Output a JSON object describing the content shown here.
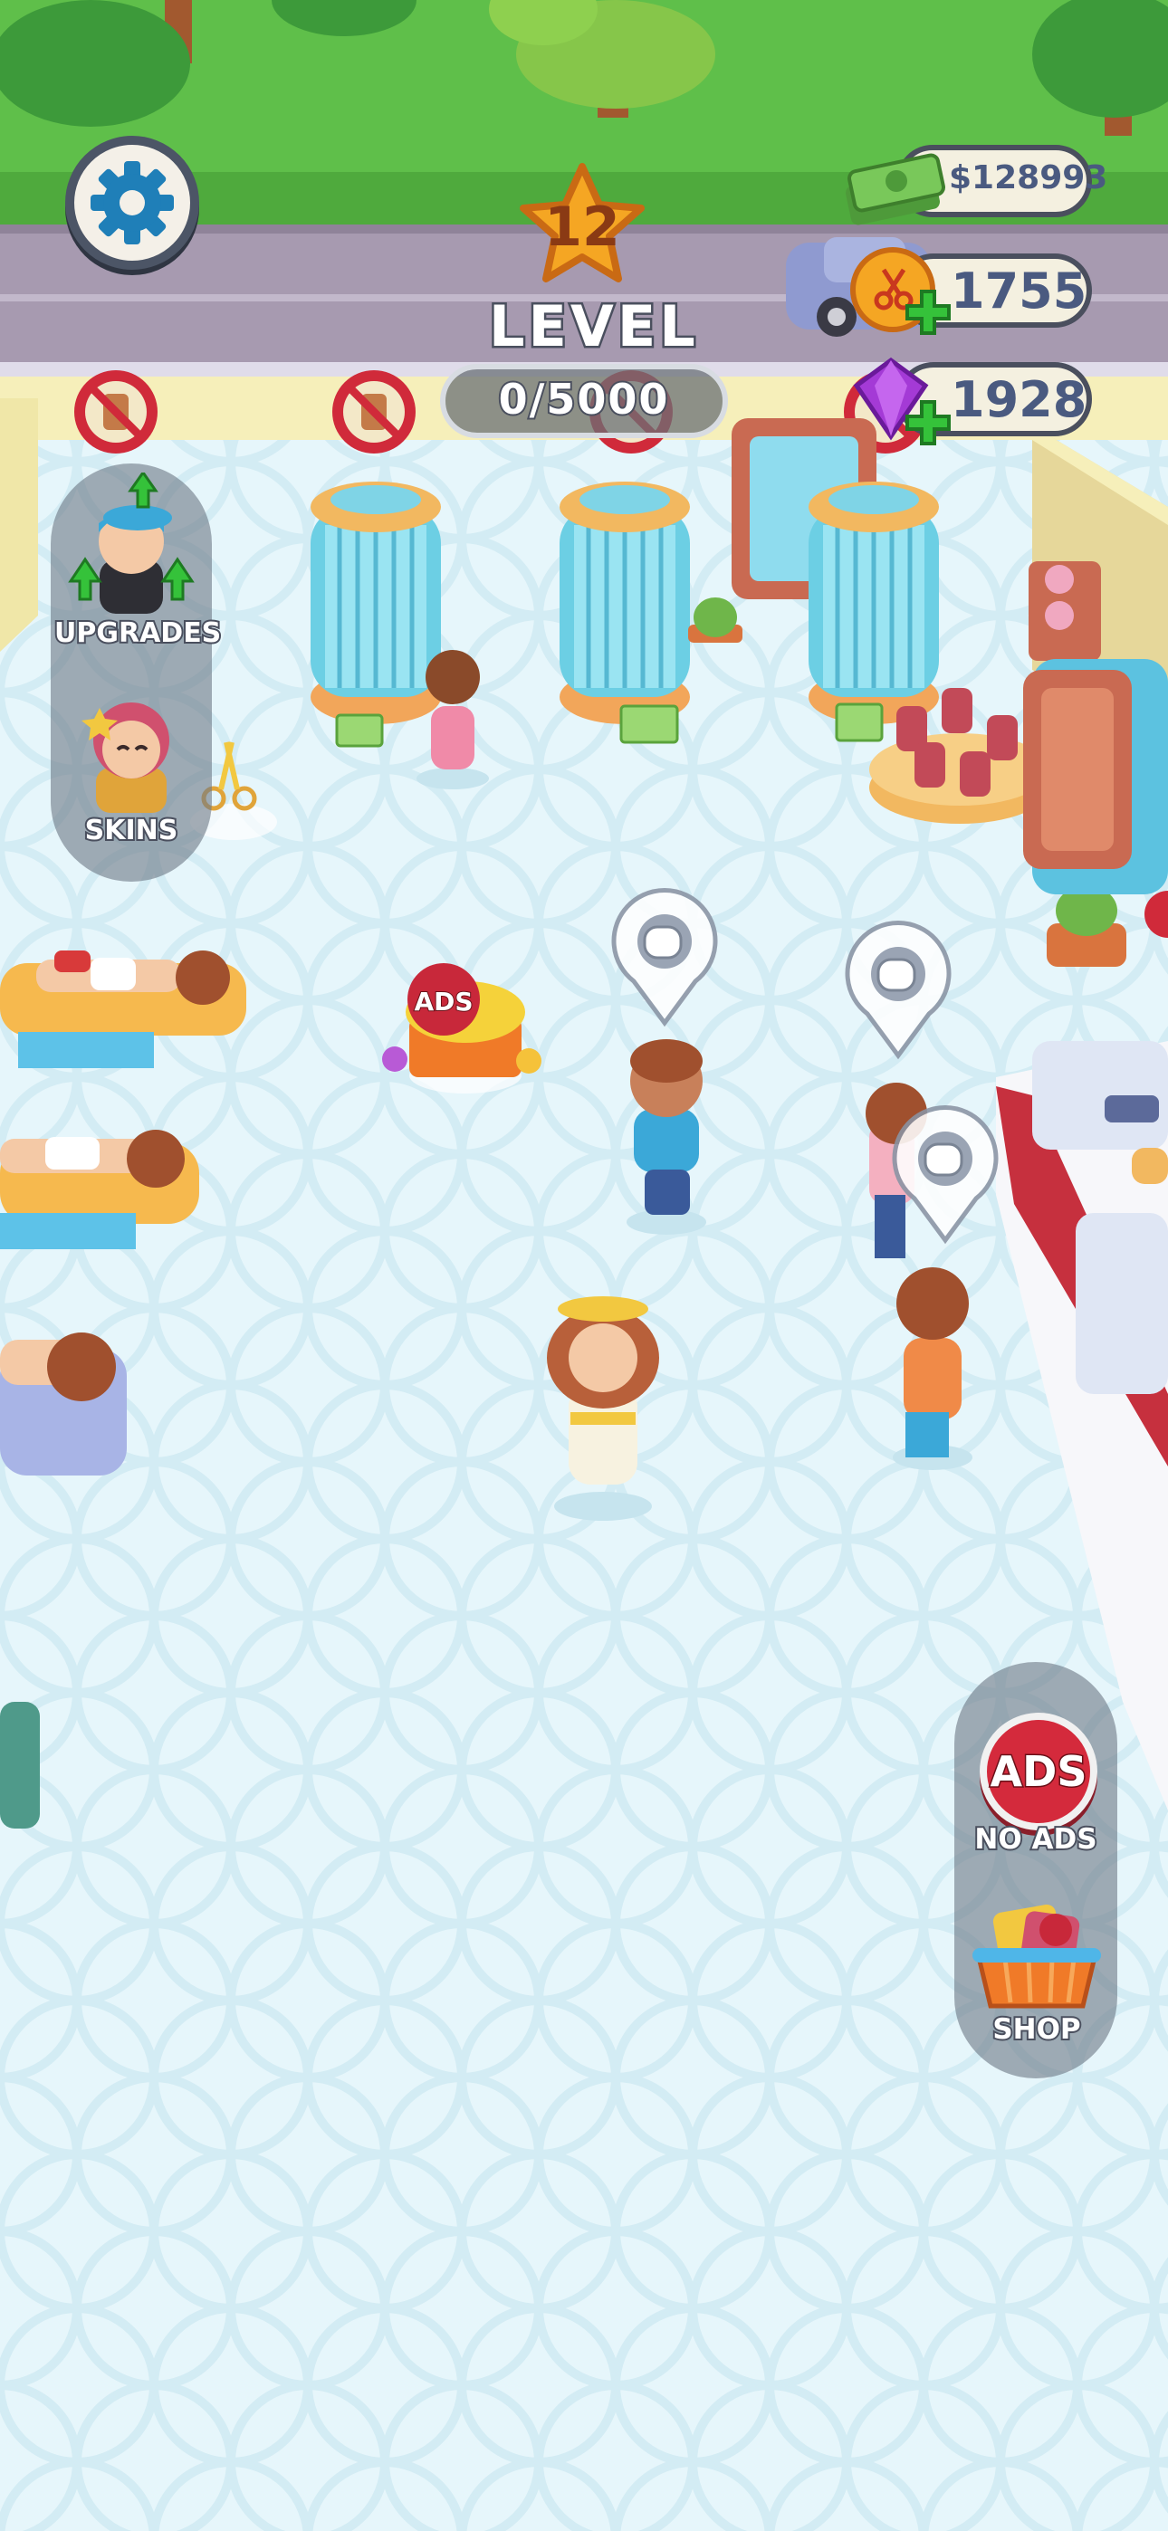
{
  "hud": {
    "level_number": "12",
    "level_label": "LEVEL",
    "level_progress": "0/5000",
    "money": "$128993",
    "scissors_currency": "1755",
    "gems": "1928"
  },
  "left_menu": {
    "upgrades_label": "UPGRADES",
    "skins_label": "SKINS"
  },
  "right_menu": {
    "no_ads_badge": "ADS",
    "no_ads_label": "NO ADS",
    "shop_label": "SHOP"
  },
  "scene": {
    "ads_reward_badge": "ADS",
    "request_icons": [
      "toilet-paper-icon",
      "toilet-paper-icon",
      "toilet-paper-icon"
    ]
  },
  "colors": {
    "floor": "#e6f6fb",
    "grass": "#5fbf4a",
    "road": "#a79ab0",
    "wall": "#f6efba",
    "hud_outline": "#4a4f5e",
    "no_ads_red": "#d42a3c"
  }
}
